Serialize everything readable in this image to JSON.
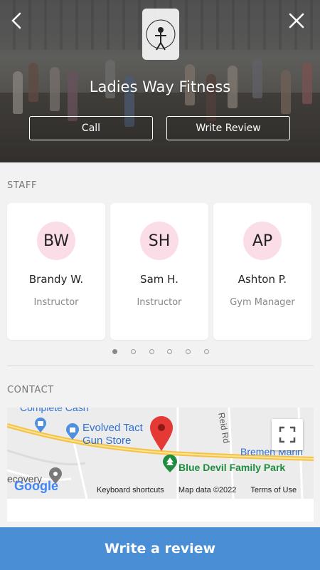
{
  "hero": {
    "title": "Ladies Way Fitness",
    "call_label": "Call",
    "write_review_label": "Write Review",
    "logo_text": "Ladies Way Fitness"
  },
  "staff": {
    "label": "STAFF",
    "members": [
      {
        "initials": "BW",
        "name": "Brandy W.",
        "role": "Instructor"
      },
      {
        "initials": "SH",
        "name": "Sam H.",
        "role": "Instructor"
      },
      {
        "initials": "AP",
        "name": "Ashton P.",
        "role": "Gym Manager"
      }
    ],
    "pager": {
      "pages": 6,
      "active_index": 0
    }
  },
  "contact": {
    "label": "CONTACT",
    "map": {
      "places": {
        "complete_cash": "Complete Cash",
        "evolved_tactical_1": "Evolved Tact",
        "evolved_tactical_2": "Gun Store",
        "reid_rd": "Reid Rd",
        "bremen_marine": "Bremen Marin",
        "blue_devil": "Blue Devil Family Park",
        "recovery": "ecovery"
      },
      "google_logo": "Google",
      "keyboard_shortcuts": "Keyboard shortcuts",
      "map_data": "Map data ©2022",
      "terms": "Terms of Use"
    }
  },
  "bottom": {
    "write_review_label": "Write a review"
  },
  "colors": {
    "accent_blue": "#4a8fd6",
    "avatar_pink": "#fbdde8",
    "road_yellow": "#f6c243",
    "pin_red": "#e53935",
    "park_green": "#1e8e3e",
    "map_label_blue": "#2f6fd1"
  }
}
